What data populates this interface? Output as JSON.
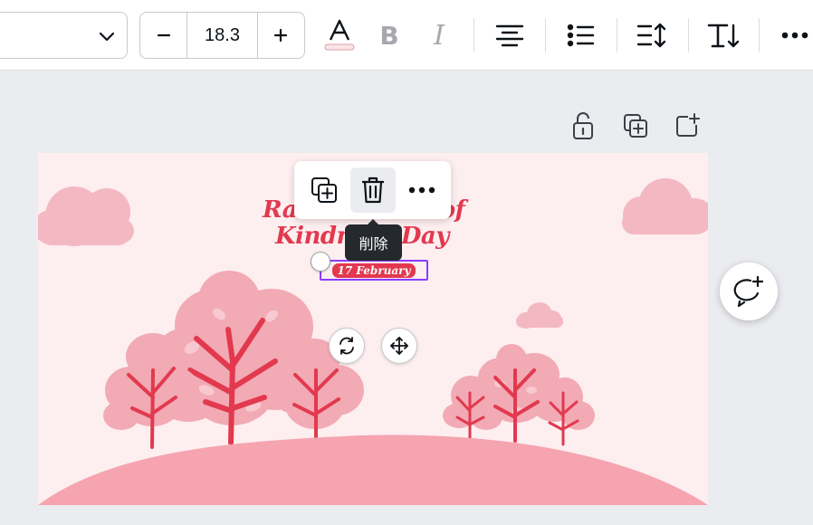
{
  "toolbar": {
    "font_name": "",
    "font_size": "18.3",
    "decrease_label": "−",
    "increase_label": "+",
    "text_color_letter": "A",
    "bold_letter": "B",
    "italic_letter": "I"
  },
  "design": {
    "title_line1": "Random Acts of",
    "title_line2": "Kindness Day",
    "date_label": "17 February"
  },
  "context_menu": {
    "tooltip": "削除"
  },
  "colors": {
    "accent_purple": "#8b3dff",
    "title_red": "#e2394f",
    "canvas_bg": "#fdeef0",
    "tree_pink": "#f2aab4"
  }
}
